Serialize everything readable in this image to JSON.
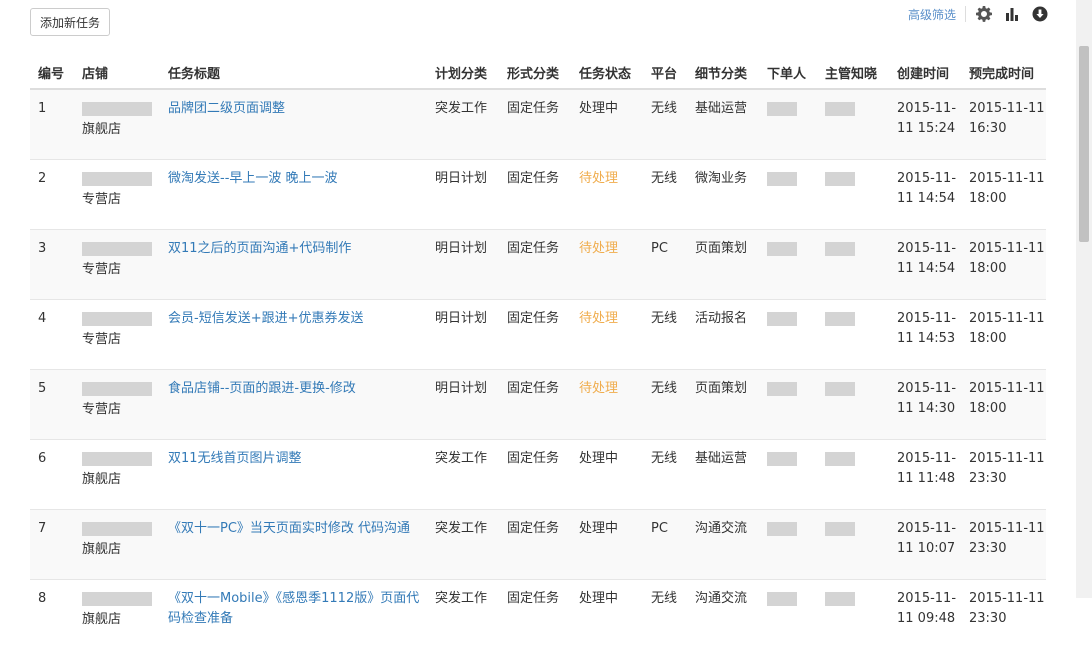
{
  "toolbar": {
    "add_task_label": "添加新任务",
    "advanced_filter_label": "高级筛选",
    "icons": [
      "gear-icon",
      "bar-chart-icon",
      "download-icon"
    ]
  },
  "colors": {
    "link": "#337ab7",
    "pending": "#f0ad4e",
    "header_border": "#dddddd"
  },
  "table": {
    "columns": [
      "编号",
      "店铺",
      "任务标题",
      "计划分类",
      "形式分类",
      "任务状态",
      "平台",
      "细节分类",
      "下单人",
      "主管知晓",
      "创建时间",
      "预完成时间"
    ],
    "rows": [
      {
        "id": "1",
        "store_suffix": "旗舰店",
        "title": "品牌团二级页面调整",
        "plan": "突发工作",
        "form": "固定任务",
        "status": "处理中",
        "status_type": "processing",
        "platform": "无线",
        "detail": "基础运营",
        "created": "2015-11-11 15:24",
        "due": "2015-11-11 16:30"
      },
      {
        "id": "2",
        "store_suffix": "专营店",
        "title": "微淘发送--早上一波 晚上一波",
        "plan": "明日计划",
        "form": "固定任务",
        "status": "待处理",
        "status_type": "pending",
        "platform": "无线",
        "detail": "微淘业务",
        "created": "2015-11-11 14:54",
        "due": "2015-11-11 18:00"
      },
      {
        "id": "3",
        "store_suffix": "专营店",
        "title": "双11之后的页面沟通+代码制作",
        "plan": "明日计划",
        "form": "固定任务",
        "status": "待处理",
        "status_type": "pending",
        "platform": "PC",
        "detail": "页面策划",
        "created": "2015-11-11 14:54",
        "due": "2015-11-11 18:00"
      },
      {
        "id": "4",
        "store_suffix": "专营店",
        "title": "会员-短信发送+跟进+优惠券发送",
        "plan": "明日计划",
        "form": "固定任务",
        "status": "待处理",
        "status_type": "pending",
        "platform": "无线",
        "detail": "活动报名",
        "created": "2015-11-11 14:53",
        "due": "2015-11-11 18:00"
      },
      {
        "id": "5",
        "store_suffix": "专营店",
        "title": "食品店铺--页面的跟进-更换-修改",
        "plan": "明日计划",
        "form": "固定任务",
        "status": "待处理",
        "status_type": "pending",
        "platform": "无线",
        "detail": "页面策划",
        "created": "2015-11-11 14:30",
        "due": "2015-11-11 18:00"
      },
      {
        "id": "6",
        "store_suffix": "旗舰店",
        "title": "双11无线首页图片调整",
        "plan": "突发工作",
        "form": "固定任务",
        "status": "处理中",
        "status_type": "processing",
        "platform": "无线",
        "detail": "基础运营",
        "created": "2015-11-11 11:48",
        "due": "2015-11-11 23:30"
      },
      {
        "id": "7",
        "store_suffix": "旗舰店",
        "title": "《双十一PC》当天页面实时修改 代码沟通",
        "plan": "突发工作",
        "form": "固定任务",
        "status": "处理中",
        "status_type": "processing",
        "platform": "PC",
        "detail": "沟通交流",
        "created": "2015-11-11 10:07",
        "due": "2015-11-11 23:30"
      },
      {
        "id": "8",
        "store_suffix": "旗舰店",
        "title": "《双十一Mobile》《感恩季1112版》页面代码检查准备",
        "plan": "突发工作",
        "form": "固定任务",
        "status": "处理中",
        "status_type": "processing",
        "platform": "无线",
        "detail": "沟通交流",
        "created": "2015-11-11 09:48",
        "due": "2015-11-11 23:30"
      }
    ]
  }
}
